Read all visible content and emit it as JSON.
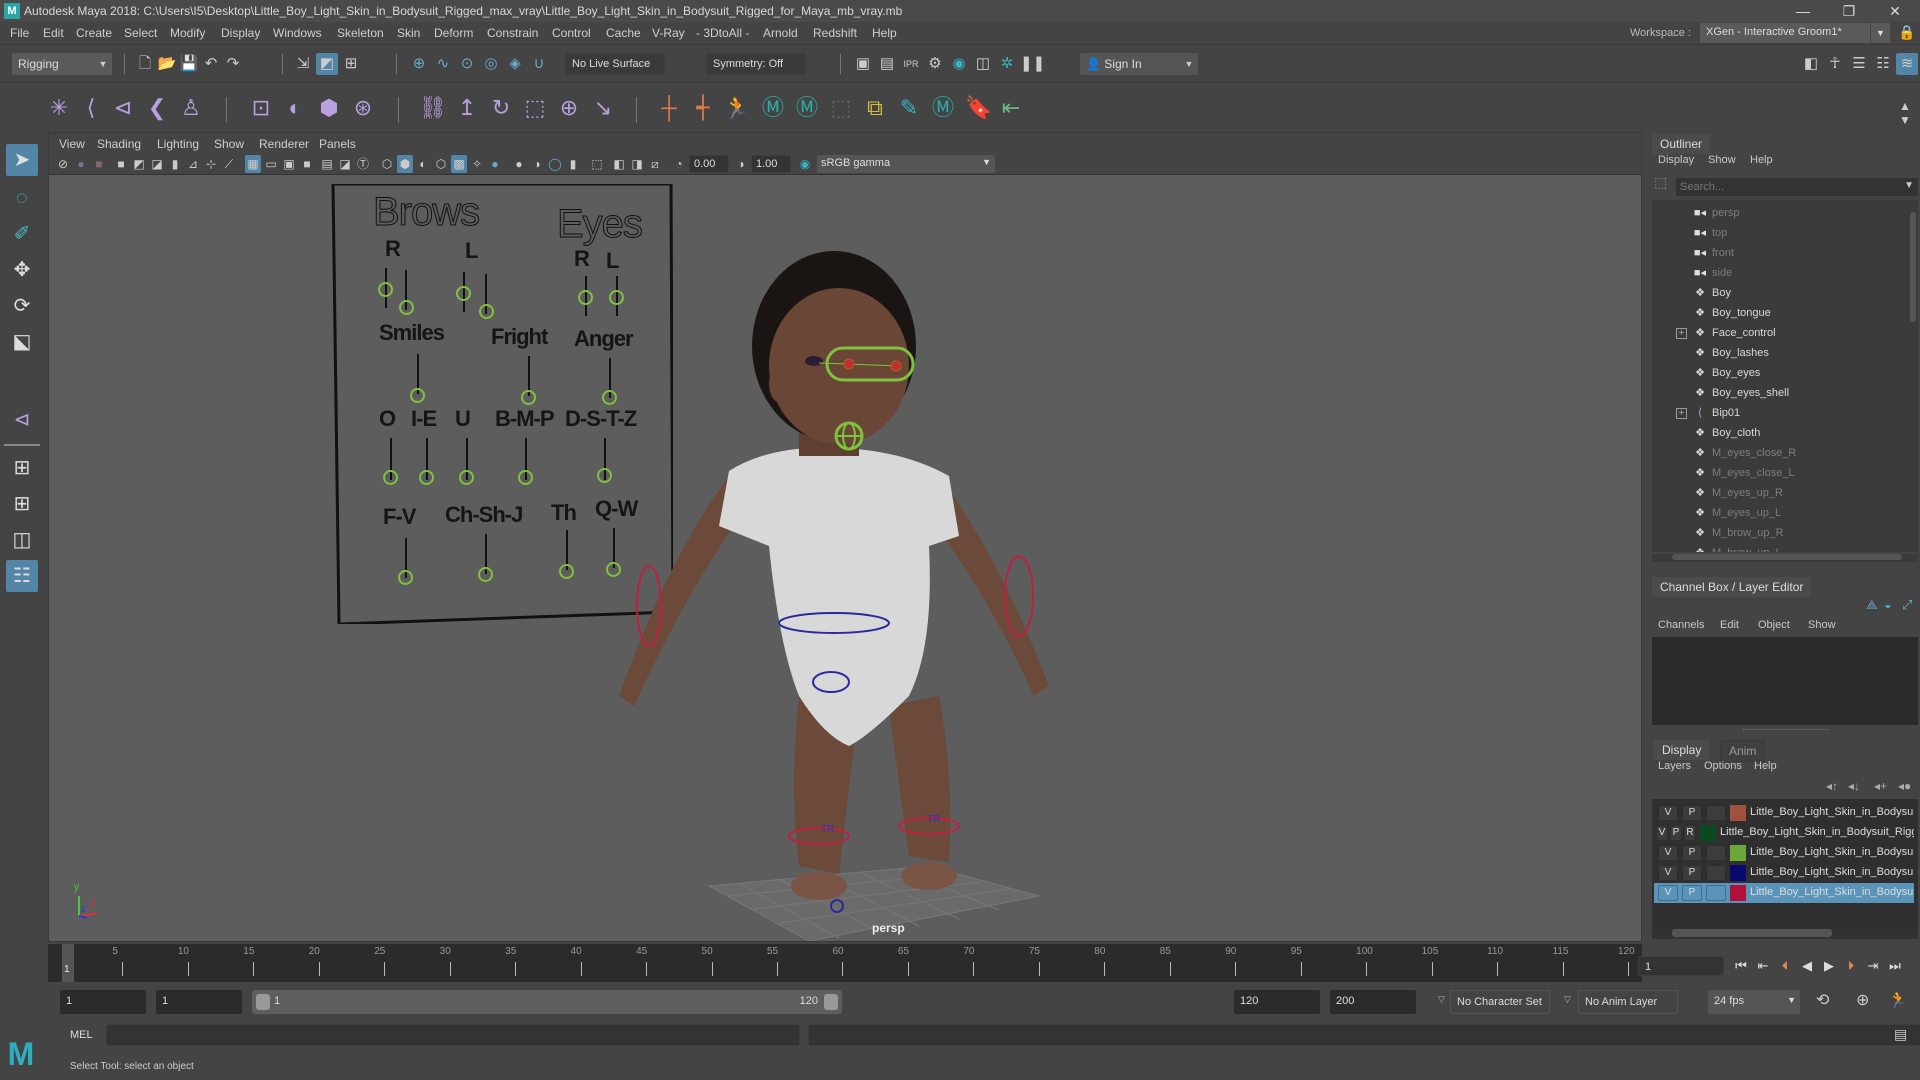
{
  "app": {
    "title": "Autodesk Maya 2018: C:\\Users\\I5\\Desktop\\Little_Boy_Light_Skin_in_Bodysuit_Rigged_max_vray\\Little_Boy_Light_Skin_in_Bodysuit_Rigged_for_Maya_mb_vray.mb",
    "logo": "M",
    "window_controls": {
      "minimize": "—",
      "maximize": "❐",
      "close": "✕"
    }
  },
  "menubar": {
    "items": [
      "File",
      "Edit",
      "Create",
      "Select",
      "Modify",
      "Display",
      "Windows",
      "Skeleton",
      "Skin",
      "Deform",
      "Constrain",
      "Control",
      "Cache",
      "V-Ray",
      "- 3DtoAll -",
      "Arnold",
      "Redshift",
      "Help"
    ],
    "workspace_label": "Workspace :",
    "workspace_value": "XGen - Interactive Groom1*"
  },
  "statusline": {
    "menuset": "Rigging",
    "live_surface": "No Live Surface",
    "symmetry": "Symmetry: Off",
    "sign_in": "Sign In"
  },
  "viewport": {
    "menus": [
      "View",
      "Shading",
      "Lighting",
      "Show",
      "Renderer",
      "Panels"
    ],
    "exposure": "0.00",
    "gamma": "1.00",
    "color_space": "sRGB gamma",
    "camera_label": "persp",
    "axis": {
      "y": "y",
      "z": "z",
      "x": "x"
    },
    "face_board": {
      "headers": [
        "Brows",
        "Eyes"
      ],
      "labels": [
        "R",
        "L",
        "R",
        "L",
        "Smiles",
        "Fright",
        "Anger",
        "O",
        "I-E",
        "U",
        "B-M-P",
        "D-S-T-Z",
        "F-V",
        "Ch-Sh-J",
        "Th",
        "Q-W"
      ]
    },
    "ankle_labels": [
      "TR",
      "TR"
    ]
  },
  "timeline": {
    "ticks": [
      "1",
      "5",
      "10",
      "15",
      "20",
      "25",
      "30",
      "35",
      "40",
      "45",
      "50",
      "55",
      "60",
      "65",
      "70",
      "75",
      "80",
      "85",
      "90",
      "95",
      "100",
      "105",
      "110",
      "115",
      "120"
    ],
    "current_frame": "1",
    "start_frame_marker": "1"
  },
  "range": {
    "start": "1",
    "playback_start": "1",
    "slider_start": "1",
    "slider_end": "120",
    "playback_end": "120",
    "end": "200",
    "character_set": "No Character Set",
    "anim_layer": "No Anim Layer",
    "fps": "24 fps"
  },
  "cmdline": {
    "label": "MEL",
    "value": ""
  },
  "helpline": {
    "text": "Select Tool: select an object"
  },
  "outliner": {
    "title": "Outliner",
    "menus": [
      "Display",
      "Show",
      "Help"
    ],
    "search_placeholder": "Search...",
    "items": [
      {
        "name": "persp",
        "icon": "camera-icon",
        "dim": true,
        "expand": false
      },
      {
        "name": "top",
        "icon": "camera-icon",
        "dim": true,
        "expand": false
      },
      {
        "name": "front",
        "icon": "camera-icon",
        "dim": true,
        "expand": false
      },
      {
        "name": "side",
        "icon": "camera-icon",
        "dim": true,
        "expand": false
      },
      {
        "name": "Boy",
        "icon": "transform-icon",
        "dim": false,
        "expand": false
      },
      {
        "name": "Boy_tongue",
        "icon": "transform-icon",
        "dim": false,
        "expand": false
      },
      {
        "name": "Face_control",
        "icon": "transform-icon",
        "dim": false,
        "expand": true
      },
      {
        "name": "Boy_lashes",
        "icon": "transform-icon",
        "dim": false,
        "expand": false
      },
      {
        "name": "Boy_eyes",
        "icon": "transform-icon",
        "dim": false,
        "expand": false
      },
      {
        "name": "Boy_eyes_shell",
        "icon": "transform-icon",
        "dim": false,
        "expand": false
      },
      {
        "name": "Bip01",
        "icon": "joint-icon",
        "dim": false,
        "expand": true
      },
      {
        "name": "Boy_cloth",
        "icon": "transform-icon",
        "dim": false,
        "expand": false
      },
      {
        "name": "M_eyes_close_R",
        "icon": "transform-icon",
        "dim": true,
        "expand": false
      },
      {
        "name": "M_eyes_close_L",
        "icon": "transform-icon",
        "dim": true,
        "expand": false
      },
      {
        "name": "M_eyes_up_R",
        "icon": "transform-icon",
        "dim": true,
        "expand": false
      },
      {
        "name": "M_eyes_up_L",
        "icon": "transform-icon",
        "dim": true,
        "expand": false
      },
      {
        "name": "M_brow_up_R",
        "icon": "transform-icon",
        "dim": true,
        "expand": false
      },
      {
        "name": "M_brow_up_L",
        "icon": "transform-icon",
        "dim": true,
        "expand": false
      }
    ]
  },
  "channelbox": {
    "title": "Channel Box / Layer Editor",
    "menus": [
      "Channels",
      "Edit",
      "Object",
      "Show"
    ],
    "tabs": [
      "Display",
      "Anim"
    ],
    "layer_menus": [
      "Layers",
      "Options",
      "Help"
    ],
    "layers": [
      {
        "v": "V",
        "p": "P",
        "r": "",
        "color": "#a0523d",
        "name": "Little_Boy_Light_Skin_in_Bodysuit",
        "selected": false
      },
      {
        "v": "V",
        "p": "P",
        "r": "R",
        "color": "#0a4a1e",
        "name": "Little_Boy_Light_Skin_in_Bodysuit_Rigg",
        "selected": false
      },
      {
        "v": "V",
        "p": "P",
        "r": "",
        "color": "#6aa83a",
        "name": "Little_Boy_Light_Skin_in_Bodysuit_R",
        "selected": false
      },
      {
        "v": "V",
        "p": "P",
        "r": "",
        "color": "#0a0a6e",
        "name": "Little_Boy_Light_Skin_in_Bodysuit",
        "selected": false
      },
      {
        "v": "V",
        "p": "P",
        "r": "",
        "color": "#b0103a",
        "name": "Little_Boy_Light_Skin_in_Bodysuit",
        "selected": true
      }
    ]
  }
}
